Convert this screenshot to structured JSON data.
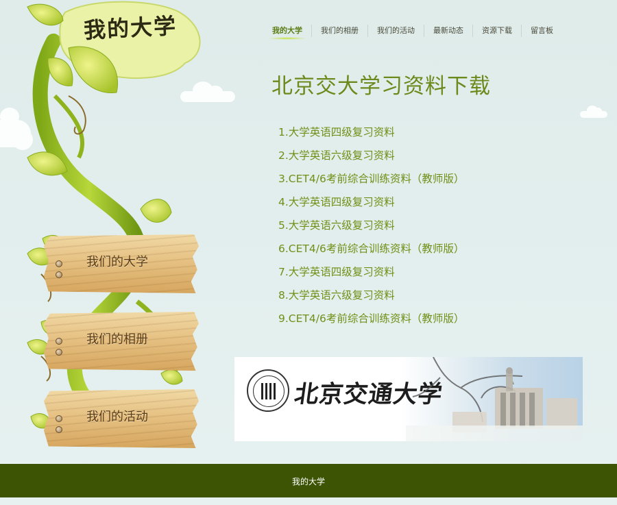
{
  "logo": {
    "title": "我的大学"
  },
  "nav": {
    "items": [
      {
        "label": "我的大学",
        "active": true
      },
      {
        "label": "我们的相册",
        "active": false
      },
      {
        "label": "我们的活动",
        "active": false
      },
      {
        "label": "最新动态",
        "active": false
      },
      {
        "label": "资源下载",
        "active": false
      },
      {
        "label": "留言板",
        "active": false
      }
    ]
  },
  "main": {
    "title": "北京交大学习资料下载",
    "downloads": [
      "1.大学英语四级复习资料",
      "2.大学英语六级复习资料",
      "3.CET4/6考前综合训练资料（教师版）",
      "4.大学英语四级复习资料",
      "5.大学英语六级复习资料",
      "6.CET4/6考前综合训练资料（教师版）",
      "7.大学英语四级复习资料",
      "8.大学英语六级复习资料",
      "9.CET4/6考前综合训练资料（教师版）"
    ],
    "banner": {
      "text": "北京交通大学"
    }
  },
  "side_signs": [
    {
      "label": "我们的大学"
    },
    {
      "label": "我们的相册"
    },
    {
      "label": "我们的活动"
    }
  ],
  "footer": {
    "text": "我的大学"
  },
  "colors": {
    "accent": "#6b8a1c",
    "footer_bg": "#3d5405",
    "page_bg": "#e3efee"
  }
}
